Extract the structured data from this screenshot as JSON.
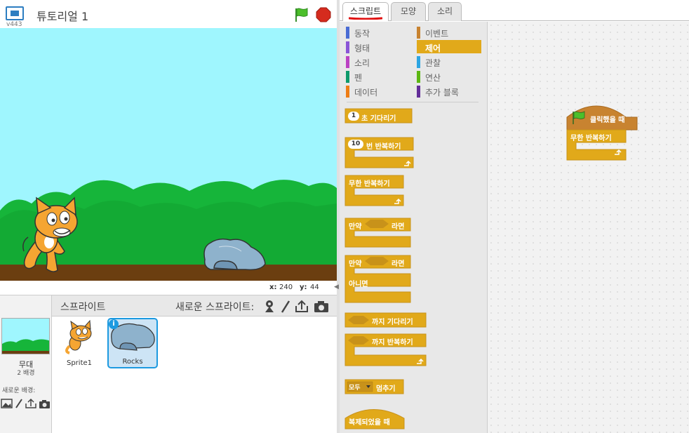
{
  "header": {
    "version": "v443",
    "project_title": "튜토리얼 1"
  },
  "stage": {
    "coords": {
      "x_label": "x:",
      "x": "240",
      "y_label": "y:",
      "y": "44"
    }
  },
  "sprite_pane": {
    "stage_label": "무대",
    "stage_count": "2 배경",
    "new_bg_label": "새로운 배경:",
    "sprites_title": "스프라이트",
    "new_sprite_label": "새로운 스프라이트:",
    "sprites": [
      {
        "name": "Sprite1"
      },
      {
        "name": "Rocks"
      }
    ],
    "info_badge": "i"
  },
  "tabs": [
    {
      "label": "스크립트"
    },
    {
      "label": "모양"
    },
    {
      "label": "소리"
    }
  ],
  "categories": [
    {
      "label": "동작",
      "color": "#4a6cd4"
    },
    {
      "label": "형태",
      "color": "#8a55d7"
    },
    {
      "label": "소리",
      "color": "#bb42c3"
    },
    {
      "label": "펜",
      "color": "#0e9a6c"
    },
    {
      "label": "데이터",
      "color": "#ee7d16"
    },
    {
      "label": "이벤트",
      "color": "#c88330"
    },
    {
      "label": "제어",
      "color": "#e1a91a"
    },
    {
      "label": "관찰",
      "color": "#2ca5e2"
    },
    {
      "label": "연산",
      "color": "#5cb712"
    },
    {
      "label": "추가 블록",
      "color": "#632d99"
    }
  ],
  "palette_blocks": {
    "wait_value": "1",
    "wait_label": "초 기다리기",
    "repeat_value": "10",
    "repeat_label": "번 반복하기",
    "forever_label": "무한 반복하기",
    "if_label": "만약",
    "then_label": "라면",
    "if2_label": "만약",
    "then2_label": "라면",
    "else_label": "아니면",
    "wait_until_label": "까지 기다리기",
    "repeat_until_label": "까지 반복하기",
    "stop_option": "모두",
    "stop_label": "멈추기",
    "clone_start_label": "복제되었을 때"
  },
  "script": {
    "hat_label": "클릭했을 때",
    "forever_label": "무한 반복하기"
  },
  "colors": {
    "control": "#e1a91a",
    "control_dark": "#c8921a",
    "events": "#c88330",
    "accent": "#1d9ae0",
    "stage_sky": "#9ff6fe"
  }
}
